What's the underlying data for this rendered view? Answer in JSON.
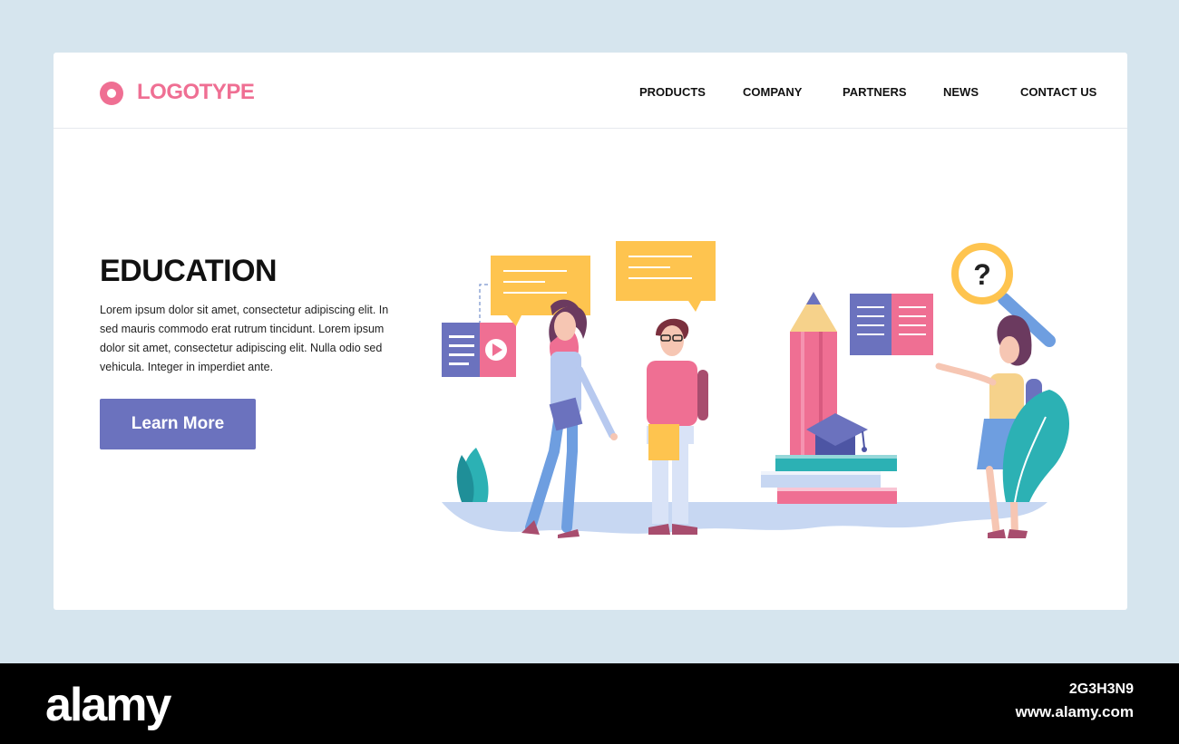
{
  "header": {
    "logo_text": "LOGOTYPE",
    "nav": [
      "PRODUCTS",
      "COMPANY",
      "PARTNERS",
      "NEWS",
      "CONTACT US"
    ]
  },
  "hero": {
    "title": "EDUCATION",
    "body": "Lorem ipsum dolor sit amet, consectetur adipiscing elit. In sed mauris commodo erat rutrum tincidunt. Lorem ipsum dolor sit amet, consectetur adipiscing elit. Nulla odio sed vehicula. Integer in imperdiet ante.",
    "cta_label": "Learn More"
  },
  "illustration": {
    "question_mark": "?"
  },
  "watermark": {
    "brand": "alamy",
    "image_id": "2G3H3N9",
    "url": "www.alamy.com"
  },
  "colors": {
    "accent_pink": "#ef6f93",
    "button_purple": "#6b72be",
    "bubble_yellow": "#fec44f",
    "teal": "#2cb1b4",
    "background": "#d6e5ee"
  }
}
